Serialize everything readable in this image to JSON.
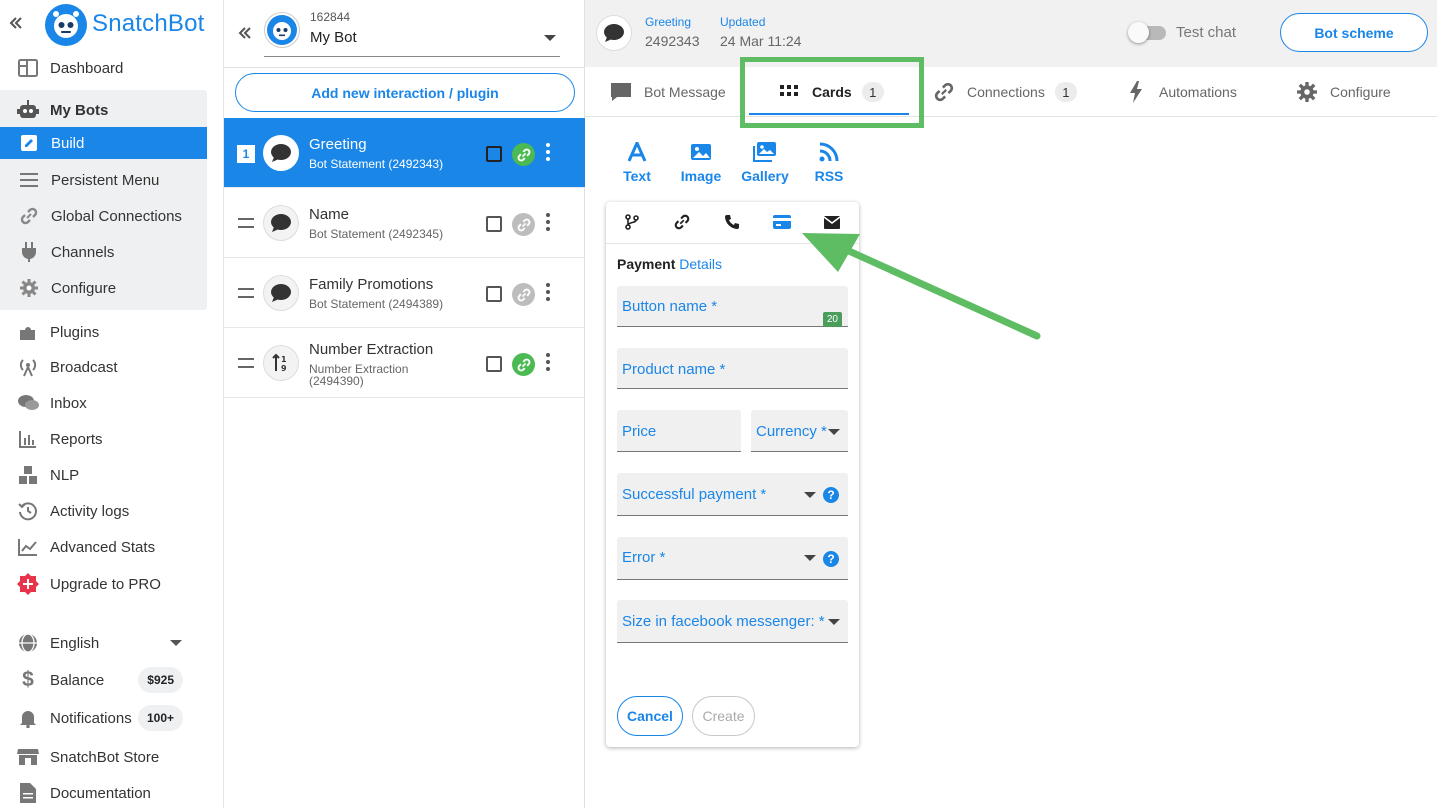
{
  "brand": {
    "name": "SnatchBot",
    "accent": "#1a86e8",
    "highlight": "#5ebd62"
  },
  "sidebar": {
    "items": [
      {
        "label": "Dashboard",
        "icon": "dashboard-icon"
      },
      {
        "label": "My Bots",
        "icon": "robot-icon"
      },
      {
        "label": "Build",
        "icon": "edit-icon"
      },
      {
        "label": "Persistent Menu",
        "icon": "menu-icon"
      },
      {
        "label": "Global Connections",
        "icon": "link-icon"
      },
      {
        "label": "Channels",
        "icon": "plug-icon"
      },
      {
        "label": "Configure",
        "icon": "gear-icon"
      },
      {
        "label": "Plugins",
        "icon": "puzzle-icon"
      },
      {
        "label": "Broadcast",
        "icon": "broadcast-icon"
      },
      {
        "label": "Inbox",
        "icon": "chat-icon"
      },
      {
        "label": "Reports",
        "icon": "bar-chart-icon"
      },
      {
        "label": "NLP",
        "icon": "cubes-icon"
      },
      {
        "label": "Activity logs",
        "icon": "history-icon"
      },
      {
        "label": "Advanced Stats",
        "icon": "line-chart-icon"
      },
      {
        "label": "Upgrade to PRO",
        "icon": "plus-badge-icon"
      }
    ],
    "language": "English",
    "balance": {
      "label": "Balance",
      "value": "$925"
    },
    "notifications": {
      "label": "Notifications",
      "value": "100+"
    },
    "store": "SnatchBot Store",
    "documentation": "Documentation"
  },
  "bot": {
    "id": "162844",
    "name": "My Bot"
  },
  "middle": {
    "add_button": "Add new interaction / plugin",
    "interactions": [
      {
        "num": "1",
        "title": "Greeting",
        "subtitle": "Bot Statement (2492343)",
        "link": "green"
      },
      {
        "title": "Name",
        "subtitle": "Bot Statement (2492345)",
        "link": "grey"
      },
      {
        "title": "Family Promotions",
        "subtitle": "Bot Statement (2494389)",
        "link": "grey"
      },
      {
        "title": "Number Extraction",
        "subtitle": "Number Extraction (2494390)",
        "link": "green"
      }
    ]
  },
  "header": {
    "interaction_label": "Greeting",
    "interaction_id": "2492343",
    "updated_label": "Updated",
    "updated_value": "24 Mar 11:24",
    "test_chat": "Test chat",
    "bot_scheme": "Bot scheme"
  },
  "tabs": [
    {
      "label": "Bot Message"
    },
    {
      "label": "Cards",
      "count": "1"
    },
    {
      "label": "Connections",
      "count": "1"
    },
    {
      "label": "Automations"
    },
    {
      "label": "Configure"
    }
  ],
  "card_types": [
    "Text",
    "Image",
    "Gallery",
    "RSS"
  ],
  "form": {
    "title_bold": "Payment",
    "title_link": "Details",
    "button_name": "Button name *",
    "button_counter": "20",
    "product_name": "Product name *",
    "price": "Price",
    "currency": "Currency *",
    "successful_payment": "Successful payment *",
    "error": "Error *",
    "size": "Size in facebook messenger: *",
    "cancel": "Cancel",
    "create": "Create"
  }
}
